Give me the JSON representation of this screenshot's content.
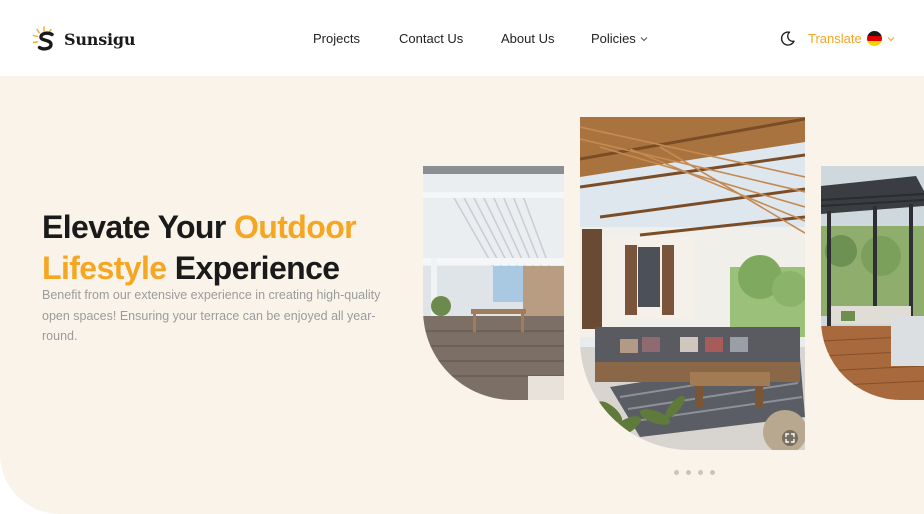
{
  "header": {
    "brand": "Sunsigu",
    "nav": [
      {
        "label": "Projects"
      },
      {
        "label": "Contact Us"
      },
      {
        "label": "About Us"
      },
      {
        "label": "Policies"
      }
    ],
    "translate_label": "Translate",
    "language_flag": "germany-flag",
    "theme_icon": "moon-icon"
  },
  "hero": {
    "title_part1": "Elevate Your ",
    "title_accent1": "Outdoor",
    "title_accent2": "Lifestyle",
    "title_part2": " Experience",
    "description": "Benefit from our extensive experience in creating high-quality open spaces! Ensuring your terrace can be enjoyed all year-round."
  },
  "carousel": {
    "slide_count": 4,
    "expand_icon": "fullscreen-icon"
  },
  "colors": {
    "accent": "#f5a623",
    "hero_bg": "#faf3ea"
  }
}
